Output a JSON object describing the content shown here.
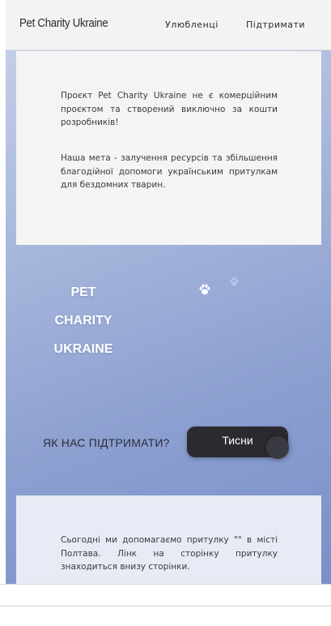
{
  "header": {
    "brand": "Pet Charity Ukraine",
    "nav": [
      {
        "label": "Улюбленці"
      },
      {
        "label": "Підтримати"
      }
    ]
  },
  "about": {
    "paragraph1": "Проєкт Pet Charity Ukraine не є комерційним проєктом та створений виключно за кошти розробників!",
    "paragraph2": "Наша мета - залучення ресурсів та збільшення благодійної допомоги українським притулкам для бездомних тварин."
  },
  "hero": {
    "line1": "PET",
    "line2": "CHARITY",
    "line3": "UKRAINE",
    "icon": "paw-icon"
  },
  "cta": {
    "label": "ЯК НАС ПІДТРИМАТИ?",
    "button": "Тисни"
  },
  "shelter": {
    "paragraph": "Сьогодні ми допомагаємо притулку \"\" в місті Полтава. Лінк на сторінку притулку знаходиться внизу сторінки."
  },
  "colors": {
    "gradient_start": "#c9d3ea",
    "gradient_end": "#7a90c8",
    "button_bg": "#2b2a30"
  }
}
